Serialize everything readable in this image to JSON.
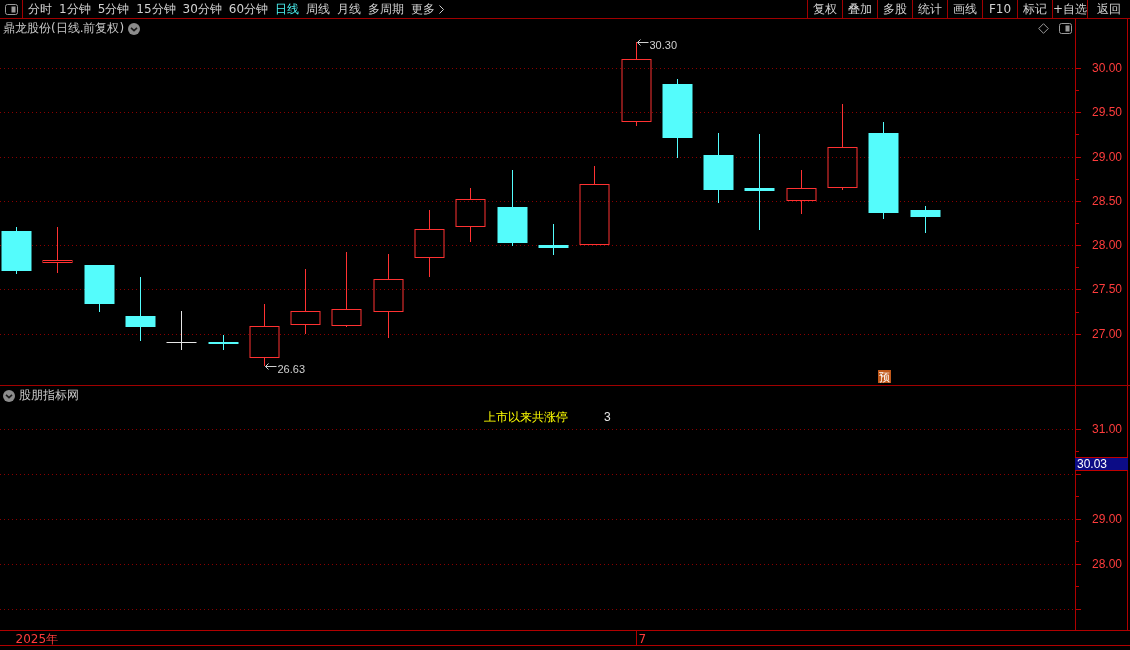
{
  "toolbar": {
    "periods": [
      {
        "label": "分时",
        "selected": false
      },
      {
        "label": "1分钟",
        "selected": false
      },
      {
        "label": "5分钟",
        "selected": false
      },
      {
        "label": "15分钟",
        "selected": false
      },
      {
        "label": "30分钟",
        "selected": false
      },
      {
        "label": "60分钟",
        "selected": false
      },
      {
        "label": "日线",
        "selected": true
      },
      {
        "label": "周线",
        "selected": false
      },
      {
        "label": "月线",
        "selected": false
      },
      {
        "label": "多周期",
        "selected": false
      }
    ],
    "more": "更多",
    "actions": [
      "复权",
      "叠加",
      "多股",
      "统计",
      "画线",
      "F10",
      "标记",
      "+自选",
      "返回"
    ]
  },
  "main_chart": {
    "title": "鼎龙股份(日线.前复权)",
    "high_label": "30.30",
    "low_label": "26.63",
    "badge": "预",
    "y_axis": [
      "30.00",
      "29.50",
      "29.00",
      "28.50",
      "28.00",
      "27.50",
      "27.00"
    ]
  },
  "indicator_panel": {
    "title": "股朋指标网",
    "label": "上市以来共涨停",
    "value": "3",
    "y_axis": [
      "31.00",
      "29.00",
      "28.00"
    ],
    "price_tag": "30.03"
  },
  "time_axis": [
    "2025年",
    "7"
  ]
}
